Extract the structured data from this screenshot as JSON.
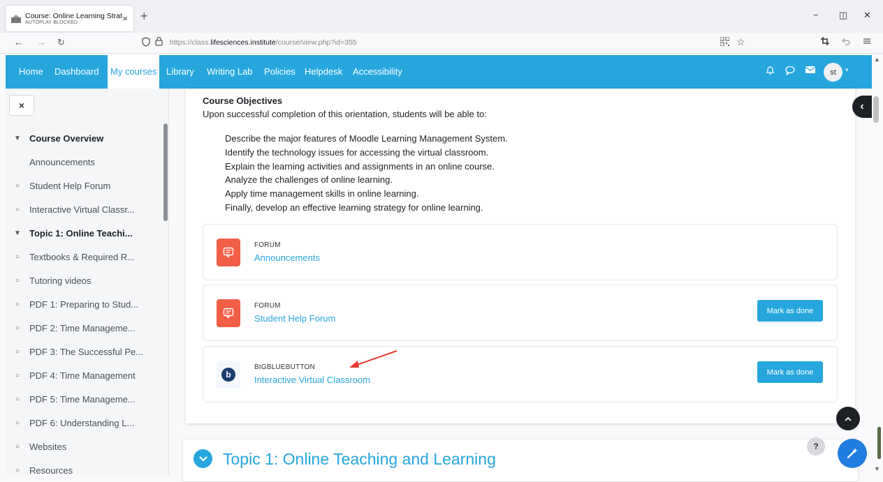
{
  "browser": {
    "tab_title": "Course: Online Learning Strat",
    "tab_subtitle": "AUTOPLAY BLOCKED",
    "tab_close": "×",
    "new_tab": "+",
    "minimize": "−",
    "restore": "◫",
    "close": "✕",
    "back": "←",
    "forward": "→",
    "reload": "↻",
    "url_prefix": "https://class.",
    "url_host": "lifesciences.institute",
    "url_path": "/course/view.php?id=355"
  },
  "moodle_nav": {
    "items": [
      "Home",
      "Dashboard",
      "My courses",
      "Library",
      "Writing Lab",
      "Policies",
      "Helpdesk",
      "Accessibility"
    ],
    "active": "My courses",
    "avatar": "st"
  },
  "drawer": {
    "close_label": "×",
    "items": [
      {
        "label": "Course Overview",
        "type": "section"
      },
      {
        "label": "Announcements",
        "type": "plain"
      },
      {
        "label": "Student Help Forum",
        "type": "link"
      },
      {
        "label": "Interactive Virtual Classr...",
        "type": "link"
      },
      {
        "label": "Topic 1: Online Teachi...",
        "type": "section"
      },
      {
        "label": "Textbooks & Required R...",
        "type": "link"
      },
      {
        "label": "Tutoring videos",
        "type": "link"
      },
      {
        "label": "PDF 1: Preparing to Stud...",
        "type": "link"
      },
      {
        "label": "PDF 2: Time Manageme...",
        "type": "link"
      },
      {
        "label": "PDF 3: The Successful Pe...",
        "type": "link"
      },
      {
        "label": "PDF 4: Time Management",
        "type": "link"
      },
      {
        "label": "PDF 5: Time Manageme...",
        "type": "link"
      },
      {
        "label": "PDF 6: Understanding L...",
        "type": "link"
      },
      {
        "label": "Websites",
        "type": "link"
      },
      {
        "label": "Resources",
        "type": "link"
      }
    ]
  },
  "objectives": {
    "heading": "Course Objectives",
    "intro": "Upon successful completion of this orientation, students will be able to:",
    "items": [
      "Describe the major features of Moodle Learning Management System.",
      "Identify the technology issues for accessing the virtual classroom.",
      "Explain the learning activities and assignments in an online course.",
      "Analyze the challenges of online learning.",
      "Apply time management skills in online learning.",
      "Finally, develop an effective learning strategy for online learning."
    ]
  },
  "activities": [
    {
      "type": "FORUM",
      "name": "Announcements",
      "button": ""
    },
    {
      "type": "FORUM",
      "name": "Student Help Forum",
      "button": "Mark as done"
    },
    {
      "type": "BIGBLUEBUTTON",
      "name": "Interactive Virtual Classroom",
      "button": "Mark as done"
    }
  ],
  "topic": {
    "title": "Topic 1: Online Teaching and Learning"
  },
  "floating": {
    "help": "?",
    "bbb_letter": "b"
  },
  "colors": {
    "accent": "#27a6de",
    "forum_icon": "#f25f47",
    "annotation": "#e8392f"
  }
}
